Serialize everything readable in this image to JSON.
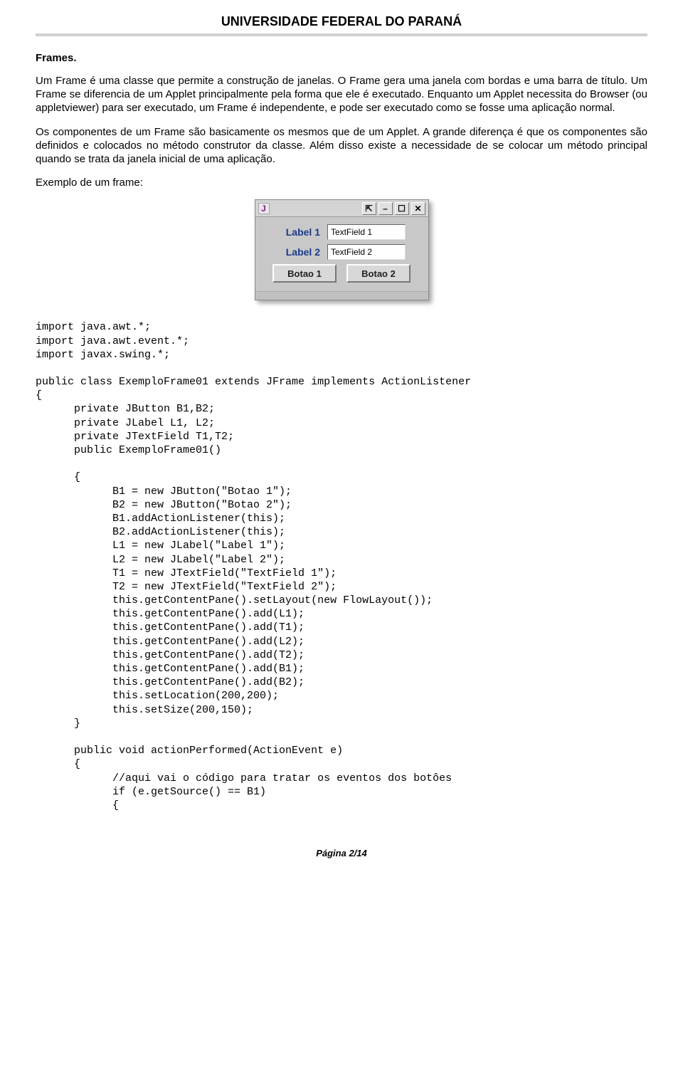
{
  "header": {
    "title": "UNIVERSIDADE FEDERAL DO PARANÁ"
  },
  "section": {
    "title": "Frames."
  },
  "paragraphs": {
    "p1": "Um Frame é uma classe que permite a construção de janelas. O Frame gera uma janela com bordas e uma barra de título. Um Frame se diferencia de um Applet principalmente pela forma que ele é executado. Enquanto um Applet necessita do Browser (ou appletviewer) para ser executado, um Frame é independente, e pode ser executado como se fosse uma aplicação normal.",
    "p2": "Os componentes de um Frame são basicamente os mesmos que de um Applet. A grande diferença é que os componentes são definidos e colocados no método construtor da classe. Além disso existe a necessidade de se colocar um método principal quando se trata da janela inicial de uma aplicação.",
    "p3": "Exemplo de um frame:"
  },
  "frame": {
    "icon_letter": "J",
    "tb": {
      "pin": "⇱",
      "min": "–",
      "max": "☐",
      "close": "✕"
    },
    "label1": "Label 1",
    "label2": "Label 2",
    "text1": "TextField 1",
    "text2": "TextField 2",
    "btn1": "Botao 1",
    "btn2": "Botao 2"
  },
  "code": {
    "block1": "import java.awt.*;\nimport java.awt.event.*;\nimport javax.swing.*;\n\npublic class ExemploFrame01 extends JFrame implements ActionListener\n{\n      private JButton B1,B2;\n      private JLabel L1, L2;\n      private JTextField T1,T2;\n      public ExemploFrame01()\n\n      {\n            B1 = new JButton(\"Botao 1\");\n            B2 = new JButton(\"Botao 2\");\n            B1.addActionListener(this);\n            B2.addActionListener(this);\n            L1 = new JLabel(\"Label 1\");\n            L2 = new JLabel(\"Label 2\");\n            T1 = new JTextField(\"TextField 1\");\n            T2 = new JTextField(\"TextField 2\");\n            this.getContentPane().setLayout(new FlowLayout());\n            this.getContentPane().add(L1);\n            this.getContentPane().add(T1);\n            this.getContentPane().add(L2);\n            this.getContentPane().add(T2);\n            this.getContentPane().add(B1);\n            this.getContentPane().add(B2);\n            this.setLocation(200,200);\n            this.setSize(200,150);\n      }\n\n      public void actionPerformed(ActionEvent e)\n      {\n            //aqui vai o código para tratar os eventos dos botôes\n            if (e.getSource() == B1)\n            {"
  },
  "footer": {
    "page": "Página 2/14"
  }
}
